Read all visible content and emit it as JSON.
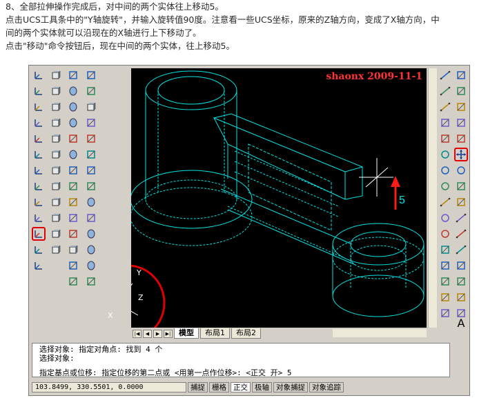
{
  "intro": {
    "line1": "8、全部拉伸操作完成后，对中间的两个实体往上移动5。",
    "line2": "点击UCS工具条中的\"Y轴旋转\"，并输入旋转值90度。注意看一些UCS坐标，原来的Z轴方向，变成了X轴方向，中",
    "line3": "间的两个实体就可以沿现在的X轴进行上下移动了。",
    "line4": "点击\"移动\"命令按钮后，现在中间的两个实体，往上移动5。"
  },
  "watermark": "shaonx 2009-11-1",
  "annotation": {
    "move_value": "5"
  },
  "ucs": {
    "y": "Y",
    "z": "Z",
    "x": "X"
  },
  "tabs": [
    {
      "label": "模型"
    },
    {
      "label": "布局1"
    },
    {
      "label": "布局2"
    }
  ],
  "command": {
    "line1": "选择对象: 指定对角点: 找到 4 个",
    "line2": "选择对象:",
    "line3": "指定基点或位移: 指定位移的第二点或 <用第一点作位移>: <正交 开> 5"
  },
  "status": {
    "coords": "103.8499, 330.5501, 0.0000",
    "buttons": [
      "捕捉",
      "栅格",
      "正交",
      "极轴",
      "对象捕捉",
      "对象追踪"
    ]
  },
  "colors": {
    "wire": "#00e5e5",
    "highlight": "#e00000",
    "canvas": "#000000"
  },
  "text_glyph": "A",
  "icons": {
    "ucs": [
      "ucs-icon",
      "ucs-world-icon",
      "ucs-previous-icon",
      "ucs-face-icon",
      "ucs-object-icon",
      "ucs-view-icon",
      "ucs-origin-icon",
      "ucs-zaxis-icon",
      "ucs-3point-icon",
      "ucs-x-rotate-icon",
      "ucs-y-rotate-icon",
      "ucs-z-rotate-icon",
      "ucs-apply-icon"
    ],
    "view": [
      "top-view-icon",
      "bottom-view-icon",
      "left-view-icon",
      "right-view-icon",
      "front-view-icon",
      "back-view-icon",
      "sw-iso-icon",
      "se-iso-icon",
      "ne-iso-icon",
      "nw-iso-icon",
      "orbit-icon",
      "camera-icon"
    ],
    "solids": [
      "box-icon",
      "sphere-icon",
      "cylinder-icon",
      "cone-icon",
      "wedge-icon",
      "torus-icon",
      "extrude-icon",
      "revolve-icon",
      "slice-icon",
      "section-icon",
      "interfere-icon",
      "setup-view-icon",
      "setup-drawing-icon",
      "setup-profile-icon"
    ],
    "draw": [
      "line-icon",
      "construction-line-icon",
      "polyline-icon",
      "polygon-icon",
      "rectangle-icon",
      "arc-icon",
      "circle-icon",
      "revision-cloud-icon",
      "spline-icon",
      "ellipse-icon",
      "ellipse-arc-icon",
      "insert-block-icon",
      "make-block-icon",
      "point-icon",
      "hatch-icon",
      "region-icon"
    ],
    "modify": [
      "erase-icon",
      "copy-icon",
      "mirror-icon",
      "offset-icon",
      "array-icon",
      "move-icon",
      "rotate-icon",
      "scale-icon",
      "stretch-icon",
      "trim-icon",
      "extend-icon",
      "break-icon",
      "join-icon",
      "chamfer-icon",
      "fillet-icon",
      "explode-icon"
    ]
  }
}
